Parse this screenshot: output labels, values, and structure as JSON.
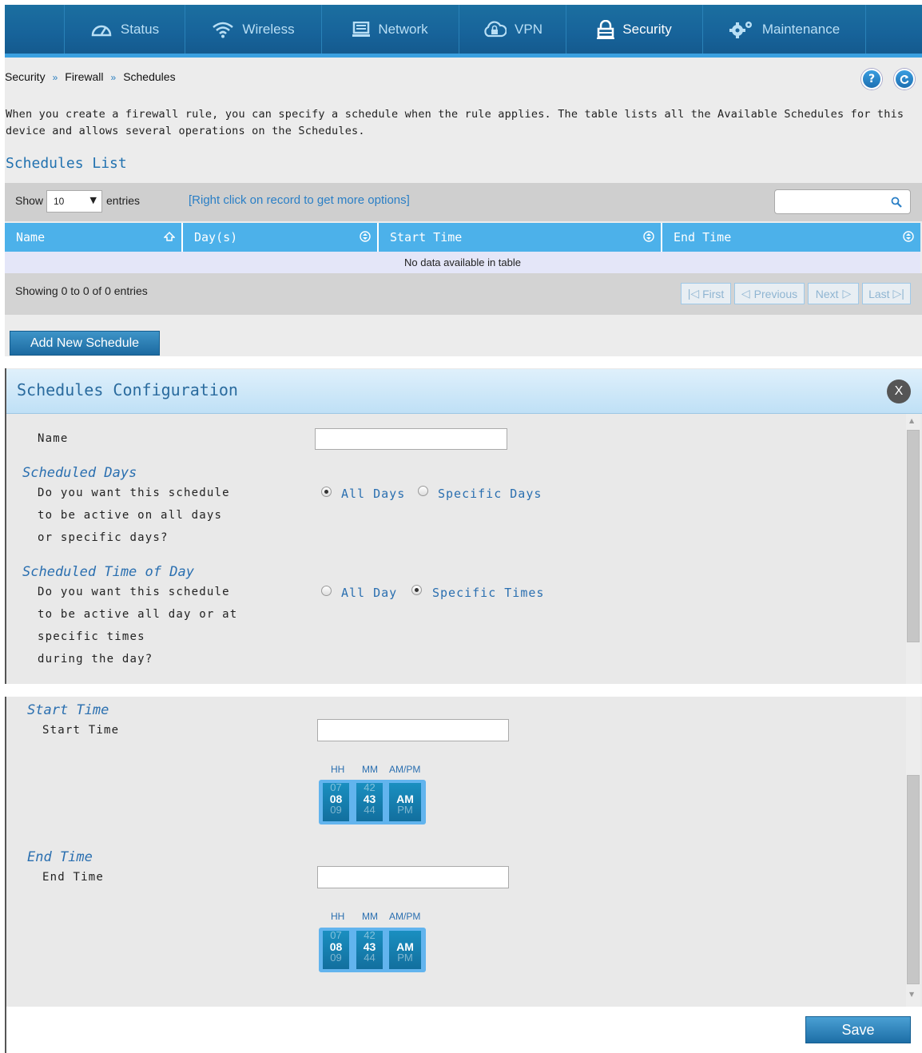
{
  "nav": {
    "items": [
      {
        "label": "Status",
        "icon": "gauge-icon"
      },
      {
        "label": "Wireless",
        "icon": "wifi-icon"
      },
      {
        "label": "Network",
        "icon": "monitor-icon"
      },
      {
        "label": "VPN",
        "icon": "cloud-lock-icon"
      },
      {
        "label": "Security",
        "icon": "lock-icon",
        "active": true
      },
      {
        "label": "Maintenance",
        "icon": "gears-icon"
      }
    ]
  },
  "breadcrumb": {
    "items": [
      "Security",
      "Firewall",
      "Schedules"
    ],
    "sep": "»"
  },
  "help_label": "?",
  "description": "When you create a firewall rule, you can specify a schedule when the rule applies. The table lists all the Available Schedules for this device and allows several operations on the Schedules.",
  "list_title": "Schedules List",
  "toolbar": {
    "show_label": "Show",
    "entries_value": "10",
    "entries_label": "entries",
    "hint": "[Right click on record to get more options]",
    "search_value": ""
  },
  "table": {
    "columns": [
      "Name",
      "Day(s)",
      "Start Time",
      "End Time"
    ],
    "empty_text": "No data available in table",
    "info": "Showing 0 to 0 of 0 entries",
    "pager": {
      "first": "First",
      "previous": "Previous",
      "next": "Next",
      "last": "Last"
    }
  },
  "add_button": "Add New Schedule",
  "dialog": {
    "title": "Schedules Configuration",
    "close_label": "X",
    "name_label": "Name",
    "name_value": "",
    "days": {
      "section": "Scheduled Days",
      "question": [
        "Do you want this schedule",
        "to be active on all days",
        "or specific days?"
      ],
      "options": [
        "All Days",
        "Specific Days"
      ],
      "selected": "All Days"
    },
    "time_of_day": {
      "section": "Scheduled Time of Day",
      "question": [
        "Do you want this schedule",
        "to be active all day or at",
        "specific times",
        "during the day?"
      ],
      "options": [
        "All Day",
        "Specific Times"
      ],
      "selected": "Specific Times"
    },
    "start": {
      "section": "Start Time",
      "label": "Start Time",
      "value": "",
      "picker": {
        "headers": [
          "HH",
          "MM",
          "AM/PM"
        ],
        "hour": [
          "07",
          "08",
          "09"
        ],
        "minute": [
          "42",
          "43",
          "44"
        ],
        "ampm": [
          "",
          "AM",
          "PM"
        ]
      }
    },
    "end": {
      "section": "End Time",
      "label": "End Time",
      "value": "",
      "picker": {
        "headers": [
          "HH",
          "MM",
          "AM/PM"
        ],
        "hour": [
          "07",
          "08",
          "09"
        ],
        "minute": [
          "42",
          "43",
          "44"
        ],
        "ampm": [
          "",
          "AM",
          "PM"
        ]
      }
    },
    "save_button": "Save"
  },
  "colors": {
    "nav_bg": "#17639a",
    "accent": "#4cb1ea",
    "link": "#2272b0"
  }
}
